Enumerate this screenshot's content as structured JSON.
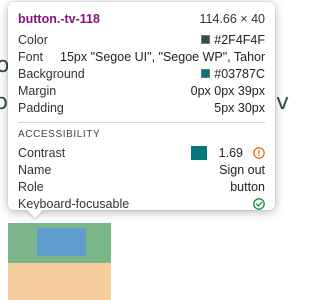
{
  "background_page": {
    "left_fragment_1": "o",
    "left_fragment_2": "p",
    "right_fragment": "v"
  },
  "tooltip": {
    "element_name": "button.-tv-118",
    "element_size": "114.66 × 40",
    "properties": {
      "color_label": "Color",
      "color_value": "#2F4F4F",
      "color_swatch": "#2F4F4F",
      "font_label": "Font",
      "font_value": "15px \"Segoe UI\", \"Segoe WP\", Tahoma...",
      "background_label": "Background",
      "background_value": "#03787C",
      "background_swatch": "#03787C",
      "margin_label": "Margin",
      "margin_value": "0px 0px 39px",
      "padding_label": "Padding",
      "padding_value": "5px 30px"
    },
    "accessibility": {
      "section_title": "ACCESSIBILITY",
      "contrast_label": "Contrast",
      "contrast_value": "1.69",
      "contrast_status_icon": "warning-circle-icon",
      "name_label": "Name",
      "name_value": "Sign out",
      "role_label": "Role",
      "role_value": "button",
      "keyboard_label": "Keyboard-focusable",
      "keyboard_status_icon": "check-circle-icon"
    }
  },
  "colors": {
    "element_name": "#881280",
    "warning": "#E8710A",
    "ok": "#1E8E3E",
    "highlight_margin": "#f6cd9d",
    "highlight_element": "#7ab689",
    "highlight_content": "#5b9ad8"
  }
}
